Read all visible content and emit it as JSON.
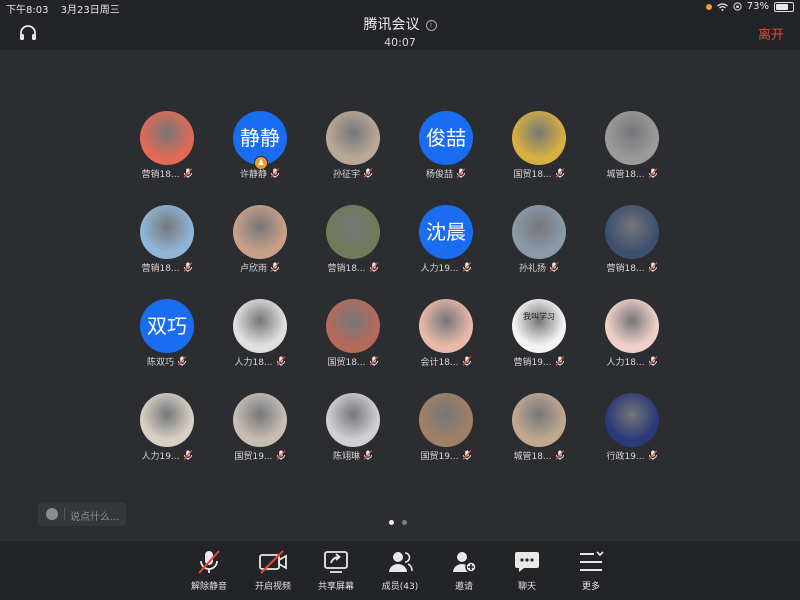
{
  "status_bar": {
    "time": "下午8:03",
    "date": "3月23日周三",
    "battery": "73%",
    "battery_level": 0.73
  },
  "header": {
    "title": "腾讯会议",
    "timer": "40:07",
    "leave_label": "离开"
  },
  "participants": [
    {
      "name": "营销18...",
      "avatar": "china-flag-cartoon",
      "bg": "#e06a55"
    },
    {
      "name": "许静静",
      "avatar_text": "静静",
      "host": true
    },
    {
      "name": "孙征宇",
      "avatar": "boy-photo",
      "bg": "#b9a896"
    },
    {
      "name": "杨俊喆",
      "avatar_text": "俊喆"
    },
    {
      "name": "国贸18...",
      "avatar": "girl-yellow-photo",
      "bg": "#d8b040"
    },
    {
      "name": "城管18...",
      "avatar": "marshmello-photo",
      "bg": "#9a9a9a"
    },
    {
      "name": "营销18...",
      "avatar": "beach-photo",
      "bg": "#8fb6d6"
    },
    {
      "name": "卢欣雨",
      "avatar": "anime-girl",
      "bg": "#c8a088"
    },
    {
      "name": "营销18...",
      "avatar": "dancer-photo",
      "bg": "#6f7a58"
    },
    {
      "name": "人力19...",
      "avatar_text": "沈晨"
    },
    {
      "name": "孙礼扬",
      "avatar": "mountain-photo",
      "bg": "#8a9aa8"
    },
    {
      "name": "营销18...",
      "avatar": "selfie-photo",
      "bg": "#3e4f6e"
    },
    {
      "name": "陈双巧",
      "avatar_text": "双巧"
    },
    {
      "name": "人力18...",
      "avatar": "panda-toy",
      "bg": "#e0e0e0"
    },
    {
      "name": "国贸18...",
      "avatar": "child-photo",
      "bg": "#b56a5a"
    },
    {
      "name": "会计18...",
      "avatar": "baby-face",
      "bg": "#e8b8a8"
    },
    {
      "name": "营销19...",
      "avatar": "meme-sticker",
      "avatar_caption": "我叫学习",
      "bg": "#f4f4f4"
    },
    {
      "name": "人力18...",
      "avatar": "baby-face-bow",
      "bg": "#f0d0c8"
    },
    {
      "name": "人力19...",
      "avatar": "polar-bear",
      "bg": "#d8d0c4"
    },
    {
      "name": "国贸19...",
      "avatar": "girl-with-dog",
      "bg": "#c8beb4"
    },
    {
      "name": "陈翊琳",
      "avatar": "sketch-girl",
      "bg": "#cfcfd4"
    },
    {
      "name": "国贸19...",
      "avatar": "teddy-bear",
      "bg": "#a08064"
    },
    {
      "name": "城管18...",
      "avatar": "toddler-photo",
      "bg": "#c0a890"
    },
    {
      "name": "行政19...",
      "avatar": "skater-photo",
      "bg": "#2a3a78"
    }
  ],
  "chat": {
    "placeholder": "说点什么..."
  },
  "pager": {
    "current": 1,
    "total": 2
  },
  "toolbar": {
    "unmute": "解除静音",
    "video": "开启视频",
    "share": "共享屏幕",
    "members": "成员(43)",
    "invite": "邀请",
    "chat": "聊天",
    "more": "更多"
  },
  "colors": {
    "background": "#2b2d31",
    "bar": "#232427",
    "leave": "#e5473d",
    "avatar_blue": "#1a6df0",
    "muted_red": "#e5473d"
  }
}
